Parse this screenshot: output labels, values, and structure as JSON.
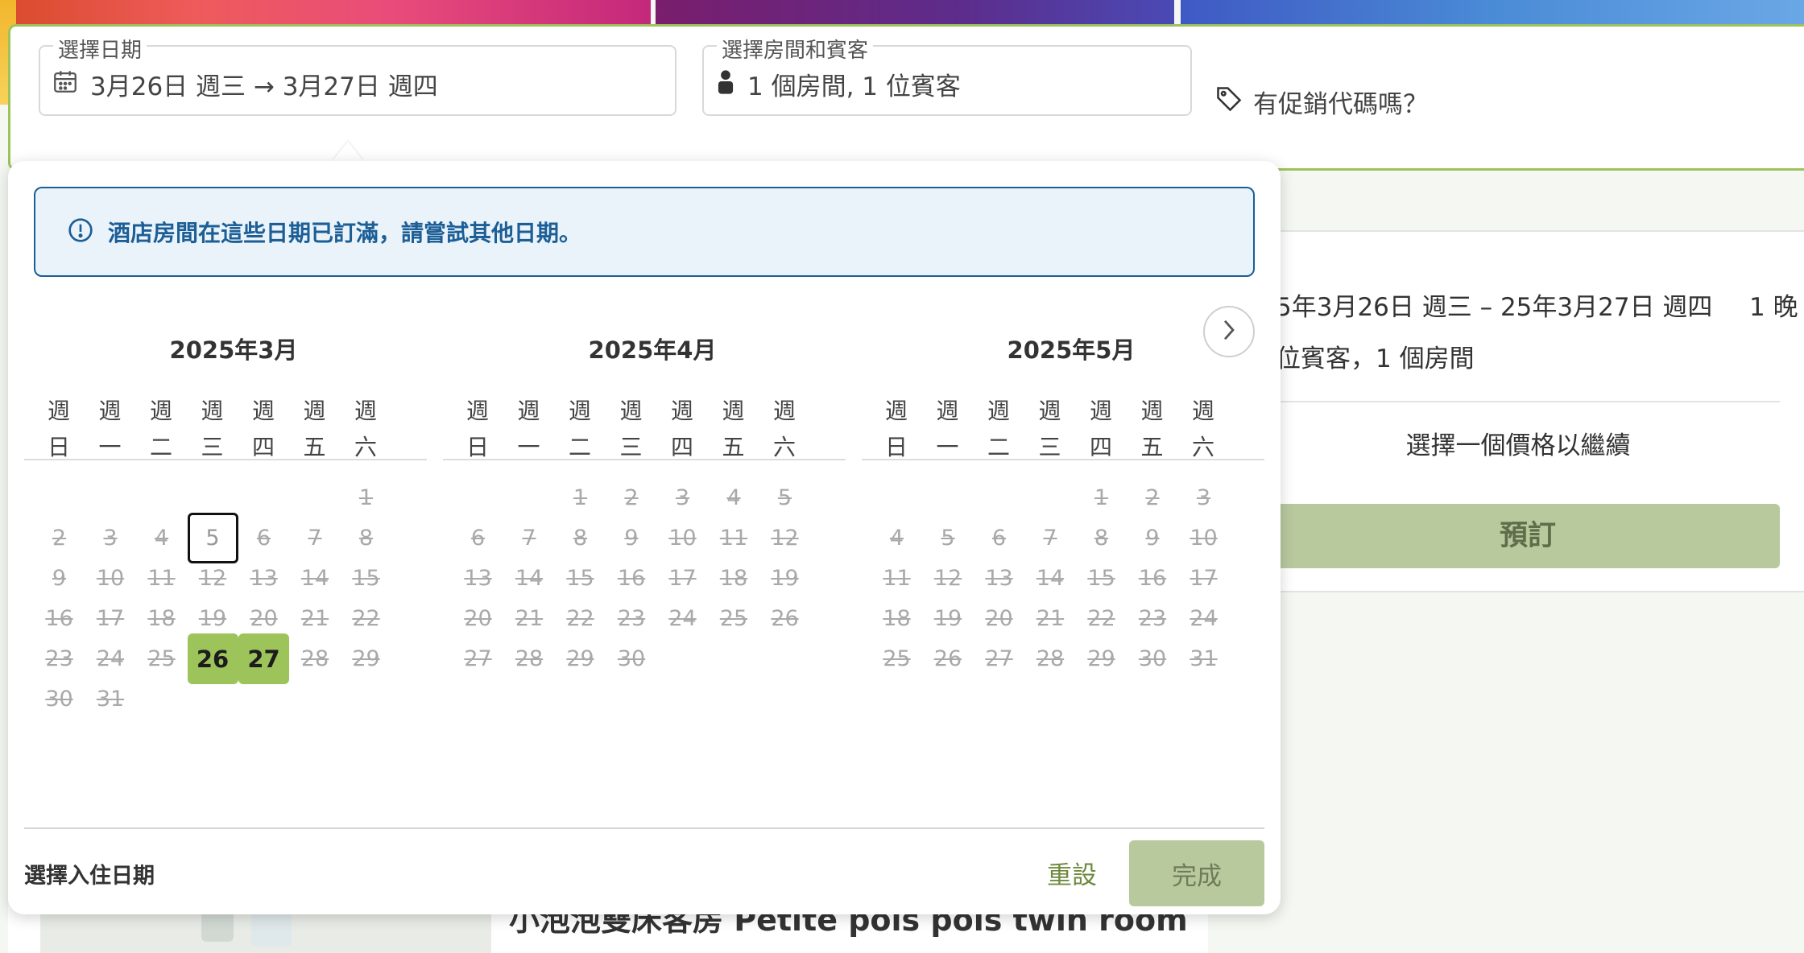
{
  "search": {
    "date_label": "選擇日期",
    "date_value": "3月26日 週三 → 3月27日 週四",
    "guest_label": "選擇房間和賓客",
    "guest_value": "1 個房間, 1 位賓客",
    "promo_label": "有促銷代碼嗎？"
  },
  "summary": {
    "dates": "5年3月26日 週三 – 25年3月27日 週四",
    "nights": "1 晚",
    "guests": "位賓客，1 個房間",
    "hint": "選擇一個價格以繼續",
    "book_label": "預訂"
  },
  "room": {
    "title": "小泡泡雙床客房 Petite pois pois twin room"
  },
  "calendar": {
    "alert": "酒店房間在這些日期已訂滿，請嘗試其他日期。",
    "weekday_line1": [
      "週",
      "週",
      "週",
      "週",
      "週",
      "週",
      "週"
    ],
    "weekday_line2": [
      "日",
      "一",
      "二",
      "三",
      "四",
      "五",
      "六"
    ],
    "months": [
      {
        "title": "2025年3月",
        "first_weekday": 6,
        "days": 31,
        "today": 5,
        "selected": [
          26,
          27
        ]
      },
      {
        "title": "2025年4月",
        "first_weekday": 2,
        "days": 30,
        "today": null,
        "selected": []
      },
      {
        "title": "2025年5月",
        "first_weekday": 4,
        "days": 31,
        "today": null,
        "selected": []
      }
    ],
    "footer_label": "選擇入住日期",
    "reset_label": "重設",
    "done_label": "完成"
  },
  "colors": {
    "accent_green": "#9cc45a",
    "alert_blue": "#1c5e96",
    "disabled_button": "#b8c99e"
  },
  "icons": [
    "calendar-icon",
    "person-icon",
    "tag-icon",
    "info-icon",
    "chevron-right-icon"
  ]
}
